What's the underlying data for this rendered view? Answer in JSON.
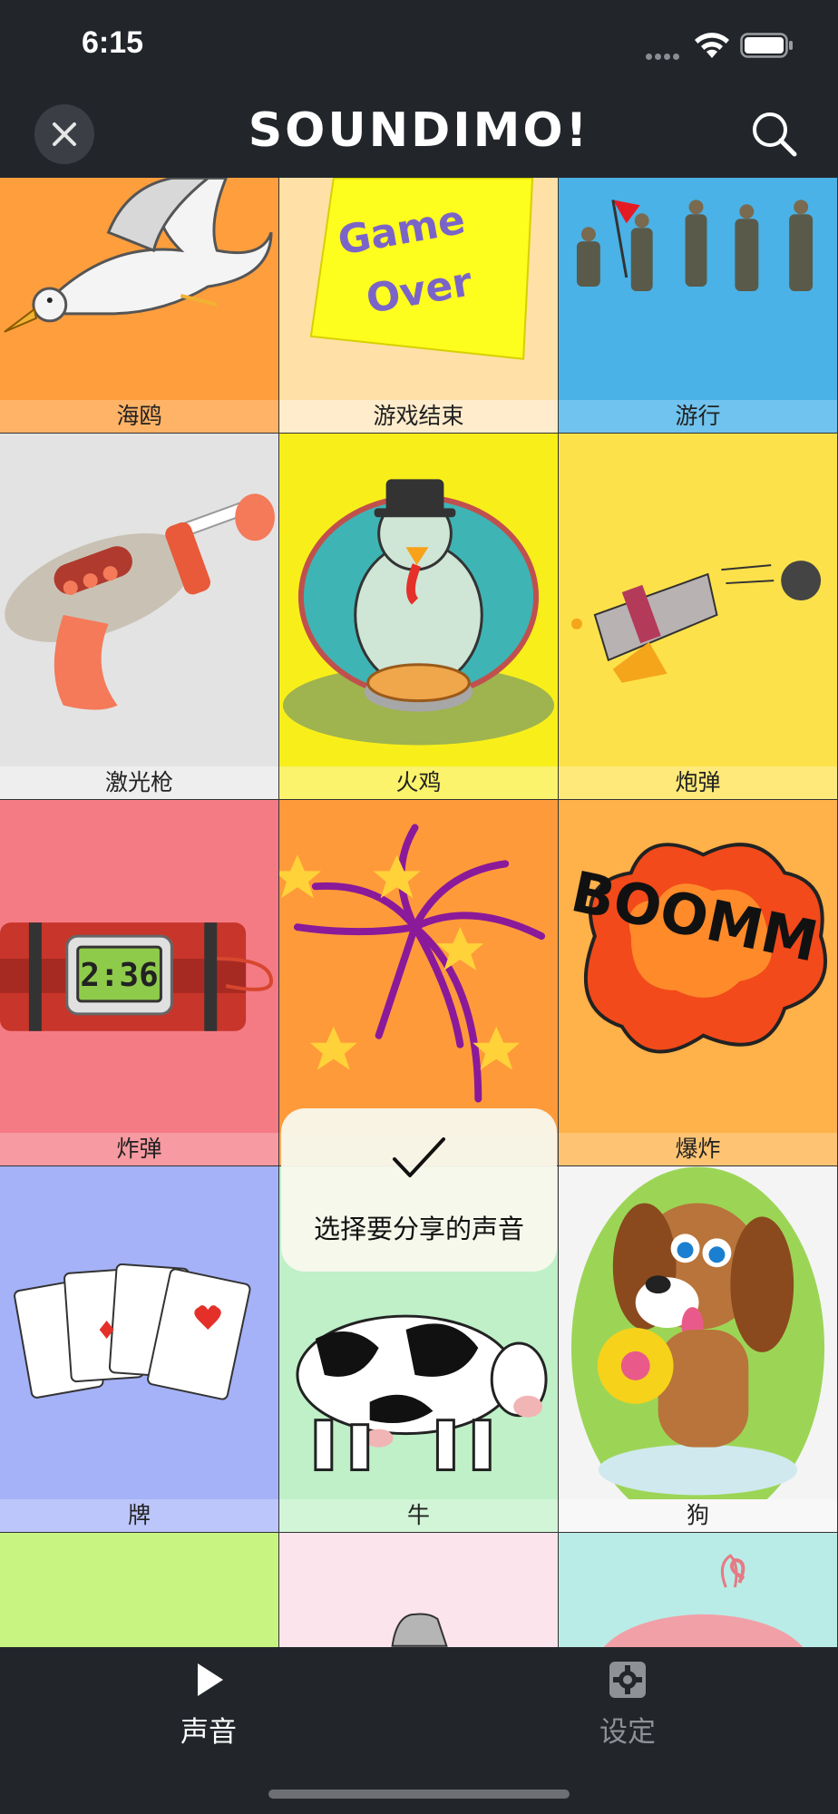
{
  "status": {
    "time": "6:15"
  },
  "header": {
    "title": "SOUNDIMO!"
  },
  "sounds": [
    {
      "label": "海鸥",
      "bg": "#ff9e3d",
      "band": "#ffb366",
      "art": "seagull-icon"
    },
    {
      "label": "游戏结束",
      "bg": "#ffe0a6",
      "band": "#ffeccc",
      "art": "game-over-note-icon",
      "note_text": [
        "Game",
        "Over"
      ]
    },
    {
      "label": "游行",
      "bg": "#4ab2e6",
      "band": "#6fc3ee",
      "art": "soldiers-parade-icon"
    },
    {
      "label": "激光枪",
      "bg": "#e3e3e3",
      "band": "#eeeeee",
      "art": "laser-gun-icon"
    },
    {
      "label": "火鸡",
      "bg": "#f8ef1a",
      "band": "#faf36b",
      "art": "turkey-icon"
    },
    {
      "label": "炮弹",
      "bg": "#fde14a",
      "band": "#fee97a",
      "art": "cannon-icon"
    },
    {
      "label": "炸弹",
      "bg": "#f47b84",
      "band": "#f79aa1",
      "art": "time-bomb-icon",
      "timer": "2:36"
    },
    {
      "label": "",
      "bg": "#ff9a3a",
      "band": "#ffad5e",
      "art": "fireworks-icon"
    },
    {
      "label": "爆炸",
      "bg": "#ffb14a",
      "band": "#ffc473",
      "art": "explosion-icon",
      "boom_text": "BOOMM"
    },
    {
      "label": "牌",
      "bg": "#a5b2f8",
      "band": "#bcc6fa",
      "art": "playing-cards-icon"
    },
    {
      "label": "牛",
      "bg": "#bff0c8",
      "band": "#d2f5d8",
      "art": "cow-icon"
    },
    {
      "label": "狗",
      "bg": "#f4f4f4",
      "band": "#f8f8f8",
      "art": "dog-icon"
    },
    {
      "label": "",
      "bg": "#c8f482",
      "band": "#c8f482",
      "art": ""
    },
    {
      "label": "",
      "bg": "#fce4ec",
      "band": "#fce4ec",
      "art": "sheep-icon"
    },
    {
      "label": "",
      "bg": "#b9ece6",
      "band": "#b9ece6",
      "art": "pig-icon"
    }
  ],
  "toast": {
    "message": "选择要分享的声音"
  },
  "tabs": [
    {
      "label": "声音",
      "icon": "play-icon",
      "active": true
    },
    {
      "label": "设定",
      "icon": "gear-icon",
      "active": false
    }
  ],
  "colors": {
    "bar": "#22262b",
    "active_tab": "#ffffff",
    "inactive_tab": "#8e9196"
  }
}
